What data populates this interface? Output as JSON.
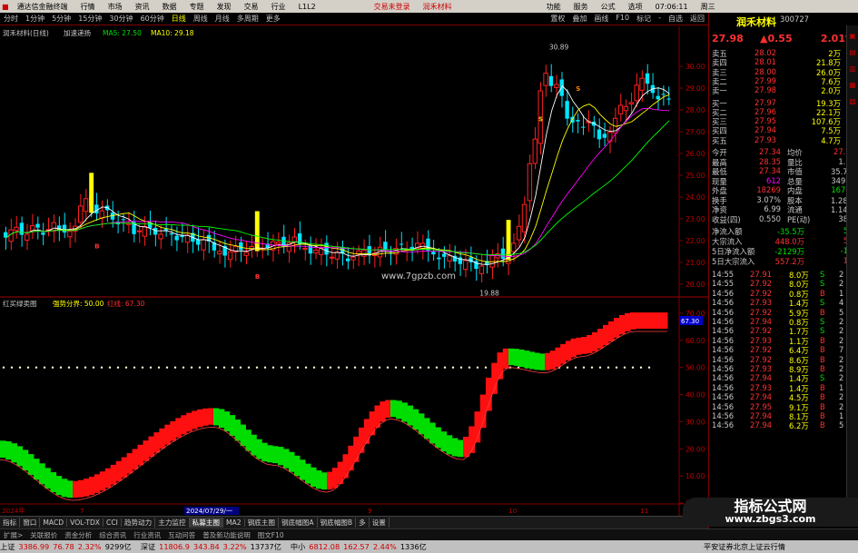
{
  "titlebar": {
    "app_name": "通达信金融终端",
    "menus": [
      "行情",
      "市场",
      "资讯",
      "数据",
      "专题",
      "发现",
      "交易",
      "行业",
      "L1L2"
    ],
    "center_items": [
      "交易未登录",
      "润禾材料"
    ],
    "right_items": [
      "功能",
      "服务",
      "公式",
      "选项",
      "07:06:11",
      "周三"
    ]
  },
  "periodbar": {
    "items": [
      "分时",
      "1分钟",
      "5分钟",
      "15分钟",
      "30分钟",
      "60分钟",
      "日线",
      "周线",
      "月线",
      "多周期",
      "更多"
    ],
    "active": "日线",
    "right_items": [
      "置权",
      "叠加",
      "画线",
      "F10",
      "标记",
      "-",
      "自选",
      "返回"
    ]
  },
  "main_chart": {
    "legend_name": "润禾材料(日线)",
    "legend_label": "加速递扬",
    "ma_labels": [
      "MA5: 27.50",
      "MA10: 29.18"
    ],
    "high_label": "30.89",
    "low_label": "19.88",
    "watermark": "www.7gpzb.com",
    "y_labels": [
      "30.00",
      "29.00",
      "28.00",
      "27.00",
      "26.00",
      "25.00",
      "24.00",
      "23.00",
      "22.00",
      "21.00",
      "20.00"
    ],
    "markers": [
      "B",
      "B",
      "S",
      "S"
    ]
  },
  "sub_chart": {
    "legend_name": "红买绿卖图",
    "legend_value": "强势分界: 50.00",
    "legend_extra": "红线: 67.30",
    "y_labels": [
      "70.00",
      "60.00",
      "50.00",
      "40.00",
      "30.00",
      "20.00",
      "10.00",
      "0.00"
    ],
    "last_label": "67.30"
  },
  "x_axis": {
    "labels": [
      "2024年",
      "7",
      "2024/07/29/一",
      "9",
      "10",
      "11"
    ]
  },
  "toolbar": {
    "items": [
      "指标",
      "窗口",
      "MACD",
      "VOL-TDX",
      "CCI",
      "趋势动力",
      "主力监控",
      "私募主图",
      "MA2",
      "钢底主图",
      "钢底幅图A",
      "钢底幅图B",
      "多",
      "设置"
    ],
    "active": "私募主图"
  },
  "tabstrip": {
    "items": [
      "扩展>",
      "关联报价",
      "资金分析",
      "综合资讯",
      "行业资讯",
      "互动问答",
      "普及新功能说明",
      "图文F10"
    ]
  },
  "right_panel": {
    "header": {
      "name": "润禾材料",
      "code": "300727"
    },
    "quote": {
      "price": "27.98",
      "change": "▲0.55",
      "pct": "2.01%"
    },
    "asks": [
      [
        "卖五",
        "28.02",
        "2万"
      ],
      [
        "卖四",
        "28.01",
        "21.8万"
      ],
      [
        "卖三",
        "28.00",
        "26.0万"
      ],
      [
        "卖二",
        "27.99",
        "7.6万"
      ],
      [
        "卖一",
        "27.98",
        "2.0万"
      ]
    ],
    "bids": [
      [
        "买一",
        "27.97",
        "19.3万"
      ],
      [
        "买二",
        "27.96",
        "22.1万"
      ],
      [
        "买三",
        "27.95",
        "107.6万"
      ],
      [
        "买四",
        "27.94",
        "7.5万"
      ],
      [
        "买五",
        "27.93",
        "4.7万"
      ]
    ],
    "stats": [
      [
        "今开",
        "27.34",
        "均价",
        "27.98"
      ],
      [
        "最高",
        "28.35",
        "量比",
        "1.00"
      ],
      [
        "最低",
        "27.34",
        "市值",
        "35.7亿"
      ],
      [
        "现量",
        "612",
        "总量",
        "34976"
      ],
      [
        "外盘",
        "18269",
        "内盘",
        "16707"
      ],
      [
        "换手",
        "3.07%",
        "股本",
        "1.28亿"
      ],
      [
        "净资",
        "6.99",
        "流通",
        "1.14亿"
      ],
      [
        "收益(四)",
        "0.550",
        "PE(动)",
        "38.3"
      ]
    ],
    "flows": [
      [
        "净流入额",
        "-35.5万",
        "5%"
      ],
      [
        "大宗流入",
        "448.0万",
        "5%"
      ],
      [
        "5日净流入额",
        "-2129万",
        "-1%"
      ],
      [
        "5日大宗流入",
        "557.2万",
        "1%"
      ]
    ],
    "ticks": [
      [
        "14:55",
        "27.91",
        "8.0万",
        "S",
        "2"
      ],
      [
        "14:55",
        "27.92",
        "8.0万",
        "S",
        "2"
      ],
      [
        "14:56",
        "27.92",
        "0.8万",
        "B",
        "1"
      ],
      [
        "14:56",
        "27.93",
        "1.4万",
        "S",
        "4"
      ],
      [
        "14:56",
        "27.92",
        "5.9万",
        "B",
        "5"
      ],
      [
        "14:56",
        "27.94",
        "0.8万",
        "S",
        "2"
      ],
      [
        "14:56",
        "27.92",
        "1.7万",
        "S",
        "2"
      ],
      [
        "14:56",
        "27.93",
        "1.1万",
        "B",
        "2"
      ],
      [
        "14:56",
        "27.92",
        "6.4万",
        "B",
        "7"
      ],
      [
        "14:56",
        "27.92",
        "8.6万",
        "B",
        "2"
      ],
      [
        "14:56",
        "27.93",
        "8.9万",
        "B",
        "2"
      ],
      [
        "14:56",
        "27.94",
        "1.4万",
        "S",
        "2"
      ],
      [
        "14:56",
        "27.93",
        "1.4万",
        "B",
        "1"
      ],
      [
        "14:56",
        "27.94",
        "4.5万",
        "B",
        "2"
      ],
      [
        "14:56",
        "27.95",
        "9.1万",
        "B",
        "2"
      ],
      [
        "14:56",
        "27.94",
        "8.1万",
        "B",
        "1"
      ],
      [
        "14:56",
        "27.94",
        "6.2万",
        "B",
        "5"
      ]
    ]
  },
  "statusbar": {
    "items": [
      "上证",
      "3386.99",
      "76.78",
      "2.32%",
      "9299亿",
      "深证",
      "11806.9",
      "343.84",
      "3.22%",
      "13737亿",
      "中小",
      "6812.08",
      "162.57",
      "2.44%",
      "1336亿"
    ],
    "right_text": "平安证券北京上证云行情"
  },
  "site_watermark": {
    "title": "指标公式网",
    "url": "www.zbgs3.com"
  },
  "colors": {
    "up": "#ff2020",
    "down": "#00e5ff",
    "sell_green": "#00d000",
    "ma_white": "#ffffff",
    "ma_yellow": "#ffff00",
    "accent": "#ffff00",
    "border": "#800000"
  },
  "chart_data": {
    "type": "candlestick",
    "title": "",
    "y_range": [
      19.5,
      31
    ],
    "high": 30.89,
    "low": 19.88,
    "sub": {
      "type": "step-area",
      "y_range": [
        0,
        72
      ],
      "threshold": 50.0,
      "last": 67.3
    }
  }
}
